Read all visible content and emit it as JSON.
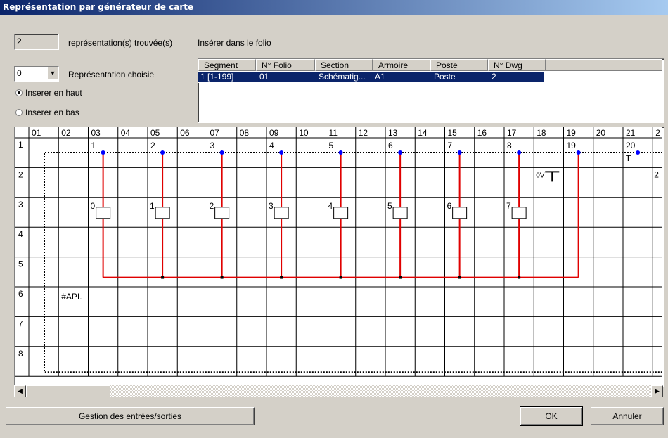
{
  "window": {
    "title": "Représentation par générateur de carte"
  },
  "found": {
    "count": "2",
    "label": "représentation(s) trouvée(s)"
  },
  "insert_folio_label": "Insérer dans le folio",
  "representation": {
    "value": "0",
    "label": "Représentation choisie"
  },
  "radios": [
    {
      "label": "Inserer en haut",
      "checked": true
    },
    {
      "label": "Inserer en bas",
      "checked": false
    }
  ],
  "table": {
    "columns": [
      "Segment",
      "N° Folio",
      "Section",
      "Armoire",
      "Poste",
      "N° Dwg"
    ],
    "rows": [
      [
        "1 [1-199]",
        "01",
        "Schématig...",
        "A1",
        "Poste",
        "2"
      ]
    ]
  },
  "grid": {
    "columns": [
      "01",
      "02",
      "03",
      "04",
      "05",
      "06",
      "07",
      "08",
      "09",
      "10",
      "11",
      "12",
      "13",
      "14",
      "15",
      "16",
      "17",
      "18",
      "19",
      "20",
      "21",
      "2"
    ],
    "rows": [
      "1",
      "2",
      "3",
      "4",
      "5",
      "6",
      "7",
      "8"
    ],
    "terminal_labels": [
      "1",
      "2",
      "3",
      "4",
      "5",
      "6",
      "7",
      "8",
      "19",
      "20"
    ],
    "box_labels": [
      "0",
      "1",
      "2",
      "3",
      "4",
      "5",
      "6",
      "7"
    ],
    "symbol_0v": "0V",
    "symbol_t": "T",
    "symbol_api": "#API.",
    "right_edge_label": "2",
    "wire_color": "#e00000",
    "terminal_color": "#0000ff"
  },
  "buttons": {
    "io_label": "Gestion des entrées/sorties",
    "ok_label": "OK",
    "cancel_label": "Annuler"
  },
  "scroll": {
    "left_icon": "arrow-left-icon",
    "right_icon": "arrow-right-icon"
  }
}
